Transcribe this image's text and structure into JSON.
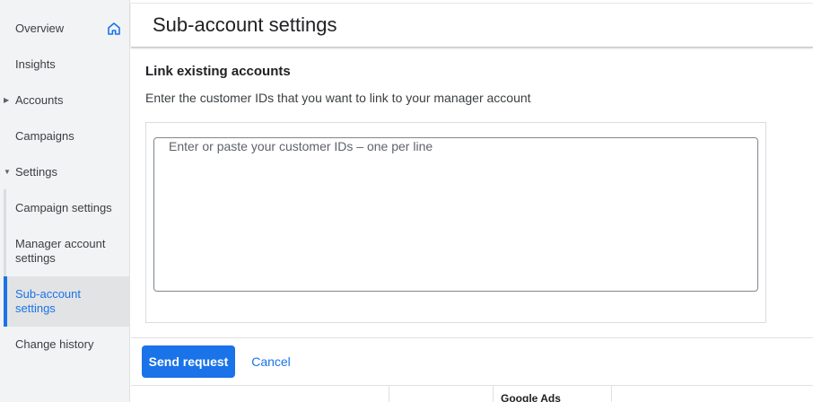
{
  "sidebar": {
    "items": [
      {
        "label": "Overview"
      },
      {
        "label": "Insights"
      },
      {
        "label": "Accounts"
      },
      {
        "label": "Campaigns"
      },
      {
        "label": "Settings"
      },
      {
        "label": "Campaign settings"
      },
      {
        "label": "Manager account settings",
        "line1": "Manager account",
        "line2": "settings"
      },
      {
        "label": "Sub-account settings",
        "line1": "Sub-account",
        "line2": "settings",
        "active": true
      },
      {
        "label": "Change history"
      }
    ]
  },
  "header": {
    "title": "Sub-account settings"
  },
  "link_section": {
    "title": "Link existing accounts",
    "description": "Enter the customer IDs that you want to link to your manager account",
    "placeholder": "Enter or paste your customer IDs – one per line",
    "value": ""
  },
  "actions": {
    "send_label": "Send request",
    "cancel_label": "Cancel"
  },
  "table_header": {
    "col_label": "Google Ads"
  },
  "colors": {
    "accent": "#1a73e8",
    "sidebar_bg": "#f1f3f4",
    "active_bg": "#e2e3e5"
  }
}
